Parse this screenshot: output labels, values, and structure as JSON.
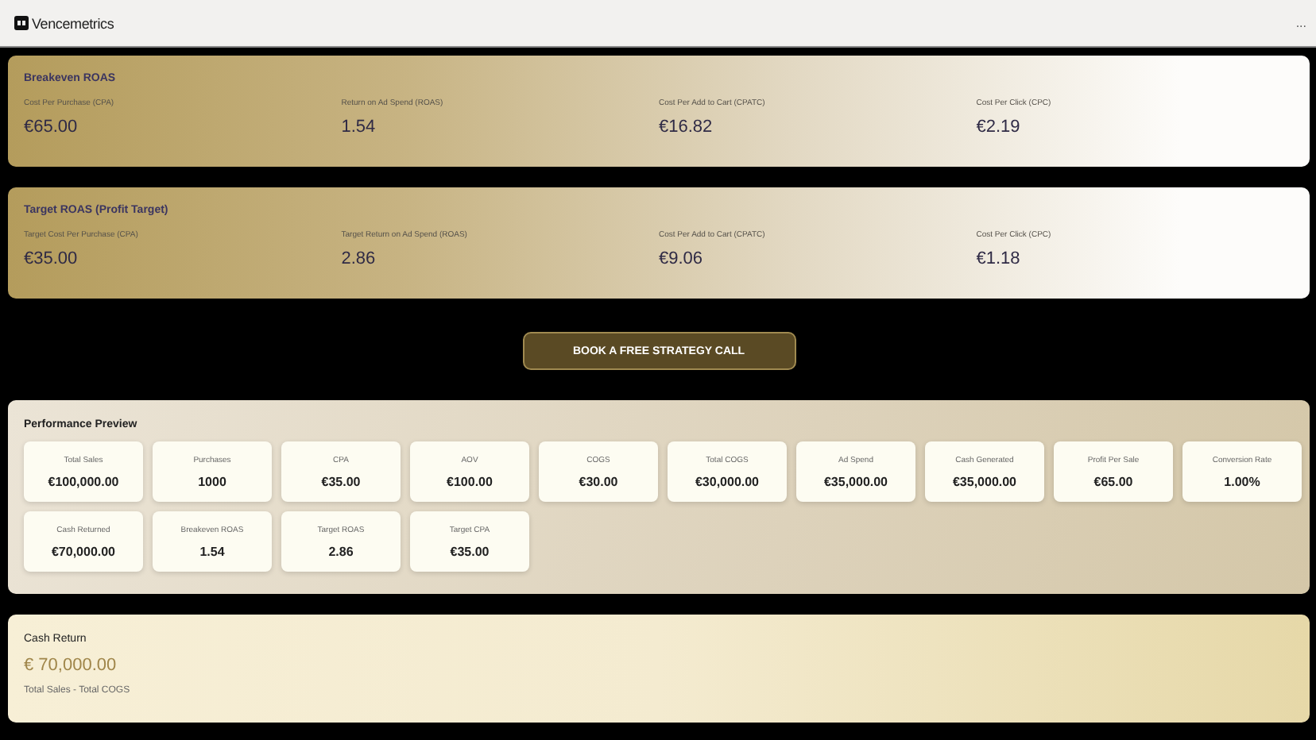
{
  "app": {
    "name": "Vencemetrics",
    "menu": "..."
  },
  "roas_cards": [
    {
      "title": "Breakeven ROAS",
      "metrics": [
        {
          "label": "Cost Per Purchase (CPA)",
          "value": "€65.00"
        },
        {
          "label": "Return on Ad Spend (ROAS)",
          "value": "1.54"
        },
        {
          "label": "Cost Per Add to Cart (CPATC)",
          "value": "€16.82"
        },
        {
          "label": "Cost Per Click (CPC)",
          "value": "€2.19"
        }
      ]
    },
    {
      "title": "Target ROAS (Profit Target)",
      "metrics": [
        {
          "label": "Target Cost Per Purchase (CPA)",
          "value": "€35.00"
        },
        {
          "label": "Target Return on Ad Spend (ROAS)",
          "value": "2.86"
        },
        {
          "label": "Cost Per Add to Cart (CPATC)",
          "value": "€9.06"
        },
        {
          "label": "Cost Per Click (CPC)",
          "value": "€1.18"
        }
      ]
    }
  ],
  "cta_button": "BOOK A FREE STRATEGY CALL",
  "performance_preview": {
    "title": "Performance Preview",
    "tiles": [
      {
        "label": "Total Sales",
        "value": "€100,000.00"
      },
      {
        "label": "Purchases",
        "value": "1000"
      },
      {
        "label": "CPA",
        "value": "€35.00"
      },
      {
        "label": "AOV",
        "value": "€100.00"
      },
      {
        "label": "COGS",
        "value": "€30.00"
      },
      {
        "label": "Total COGS",
        "value": "€30,000.00"
      },
      {
        "label": "Ad Spend",
        "value": "€35,000.00"
      },
      {
        "label": "Cash Generated",
        "value": "€35,000.00"
      },
      {
        "label": "Profit Per Sale",
        "value": "€65.00"
      },
      {
        "label": "Conversion Rate",
        "value": "1.00%"
      },
      {
        "label": "Cash Returned",
        "value": "€70,000.00"
      },
      {
        "label": "Breakeven ROAS",
        "value": "1.54"
      },
      {
        "label": "Target ROAS",
        "value": "2.86"
      },
      {
        "label": "Target CPA",
        "value": "€35.00"
      }
    ]
  },
  "cash_return": {
    "title": "Cash Return",
    "value": "€ 70,000.00",
    "formula": "Total Sales - Total COGS"
  }
}
